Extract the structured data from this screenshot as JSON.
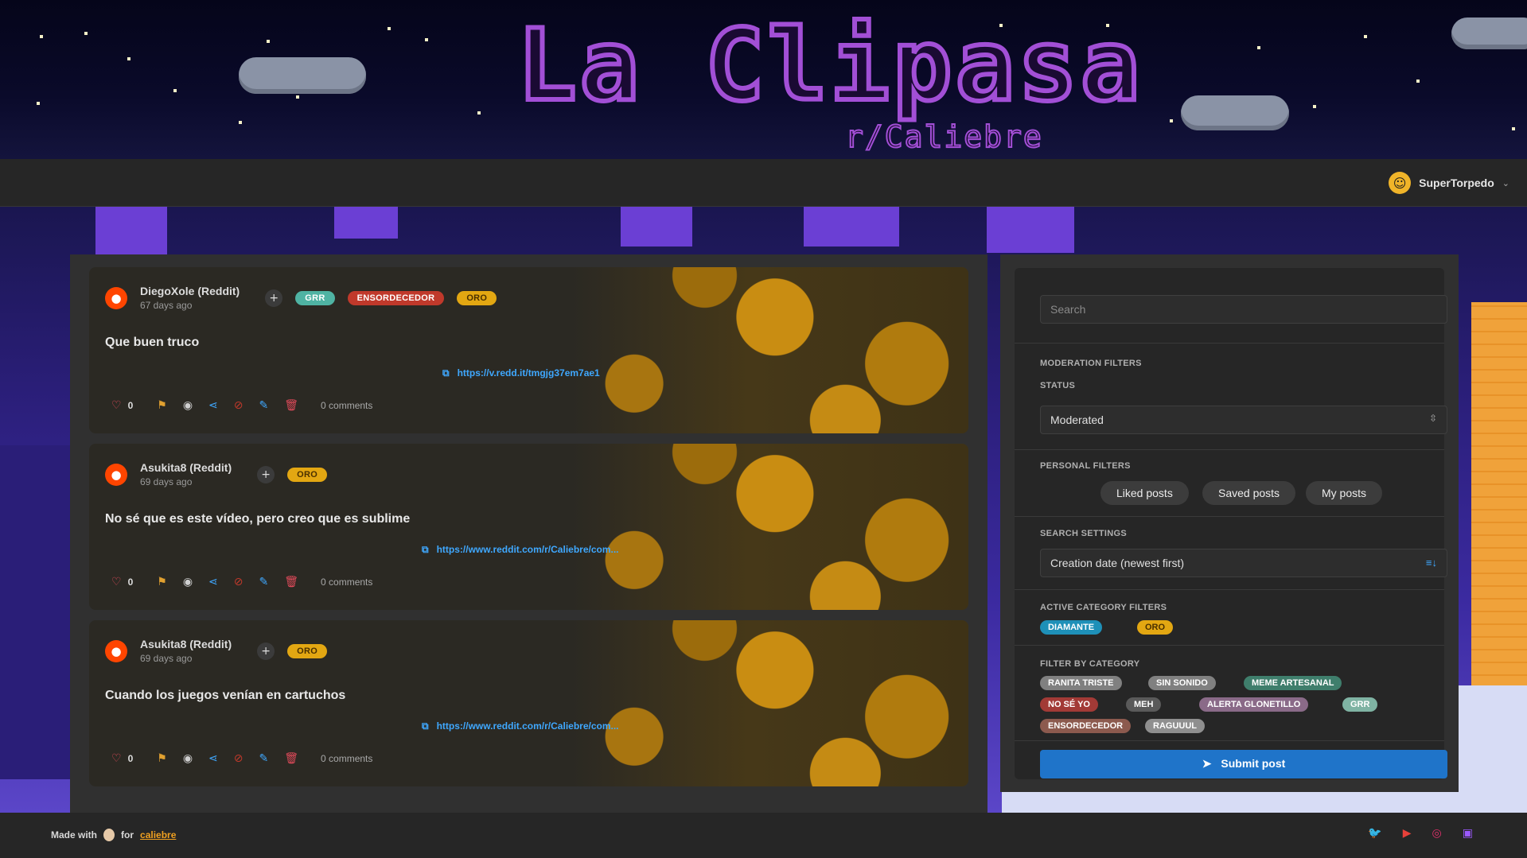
{
  "site": {
    "logo_title": "La Clipasa",
    "logo_subtitle": "r/Caliebre"
  },
  "navbar": {
    "username": "SuperTorpedo"
  },
  "posts": [
    {
      "author": "DiegoXole (Reddit)",
      "date": "67 days ago",
      "tags": [
        "GRR",
        "ENSORDECEDOR",
        "ORO"
      ],
      "title": "Que buen truco",
      "link": "https://v.redd.it/tmgjg37em7ae1",
      "likes": "0",
      "comments": "0 comments"
    },
    {
      "author": "Asukita8 (Reddit)",
      "date": "69 days ago",
      "tags": [
        "ORO"
      ],
      "title": "No sé que es este vídeo, pero creo que es sublime",
      "link": "https://www.reddit.com/r/Caliebre/com...",
      "likes": "0",
      "comments": "0 comments"
    },
    {
      "author": "Asukita8 (Reddit)",
      "date": "69 days ago",
      "tags": [
        "ORO"
      ],
      "title": "Cuando los juegos venían en cartuchos",
      "link": "https://www.reddit.com/r/Caliebre/com...",
      "likes": "0",
      "comments": "0 comments"
    }
  ],
  "sidebar": {
    "search_placeholder": "Search",
    "moderation_title": "MODERATION FILTERS",
    "status_label": "STATUS",
    "status_value": "Moderated",
    "personal_title": "PERSONAL FILTERS",
    "personal_buttons": [
      "Liked posts",
      "Saved posts",
      "My posts"
    ],
    "search_settings_title": "SEARCH SETTINGS",
    "sort_value": "Creation date (newest first)",
    "active_title": "ACTIVE CATEGORY FILTERS",
    "active_chips": [
      "DIAMANTE",
      "ORO"
    ],
    "category_title": "FILTER BY CATEGORY",
    "category_chips": [
      "RANITA TRISTE",
      "SIN SONIDO",
      "MEME ARTESANAL",
      "NO SÉ YO",
      "MEH",
      "ALERTA GLONETILLO",
      "GRR",
      "ENSORDECEDOR",
      "RAGUUUL"
    ],
    "submit_label": "Submit post"
  },
  "footer": {
    "made_with": "Made with",
    "for_text": "for",
    "link_text": "caliebre"
  },
  "colors": {
    "accent_blue": "#1f74c9",
    "link_blue": "#3fa8ff",
    "gold": "#e3a712",
    "reddit_orange": "#ff4500"
  }
}
